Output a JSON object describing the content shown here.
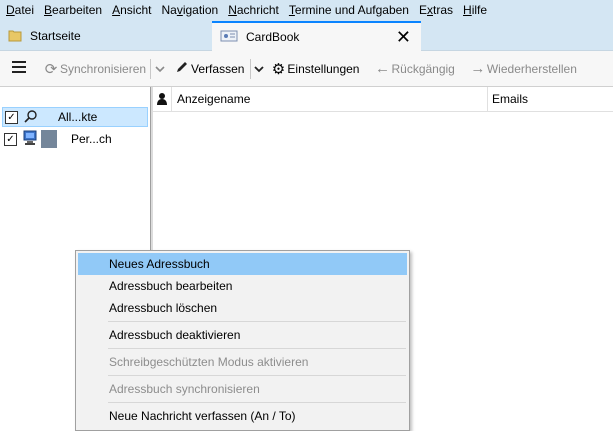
{
  "menubar": {
    "items": [
      {
        "key": "D",
        "rest": "atei"
      },
      {
        "key": "B",
        "rest": "earbeiten"
      },
      {
        "key": "A",
        "rest": "nsicht"
      },
      {
        "key": "",
        "pre": "Na",
        "k2": "v",
        "post": "igation"
      },
      {
        "key": "N",
        "rest": "achricht"
      },
      {
        "key": "T",
        "rest": "ermine und Aufgaben"
      },
      {
        "key": "",
        "pre": "E",
        "k2": "x",
        "post": "tras"
      },
      {
        "key": "H",
        "rest": "ilfe"
      }
    ]
  },
  "tabs": {
    "start_label": "Startseite",
    "active_label": "CardBook",
    "close_glyph": "✕"
  },
  "toolbar": {
    "sync_label": "Synchronisieren",
    "compose_label": "Verfassen",
    "settings_label": "Einstellungen",
    "undo_label": "Rückgängig",
    "redo_label": "Wiederherstellen"
  },
  "addressbooks": [
    {
      "name": "All...kte",
      "checked": true,
      "selected": true
    },
    {
      "name": "Per...ch",
      "checked": true,
      "selected": false
    }
  ],
  "columns": {
    "display_name": "Anzeigename",
    "emails": "Emails"
  },
  "context_menu": {
    "new_ab": "Neues Adressbuch",
    "edit_ab": "Adressbuch bearbeiten",
    "delete_ab": "Adressbuch löschen",
    "disable_ab": "Adressbuch deaktivieren",
    "readonly": "Schreibgeschützten Modus aktivieren",
    "sync_ab": "Adressbuch synchronisieren",
    "new_message": "Neue Nachricht verfassen (An / To)"
  },
  "colors": {
    "chrome": "#d4e6f3",
    "accent": "#0a84ff",
    "selection": "#cce8ff",
    "menu_highlight": "#91c9f7"
  }
}
